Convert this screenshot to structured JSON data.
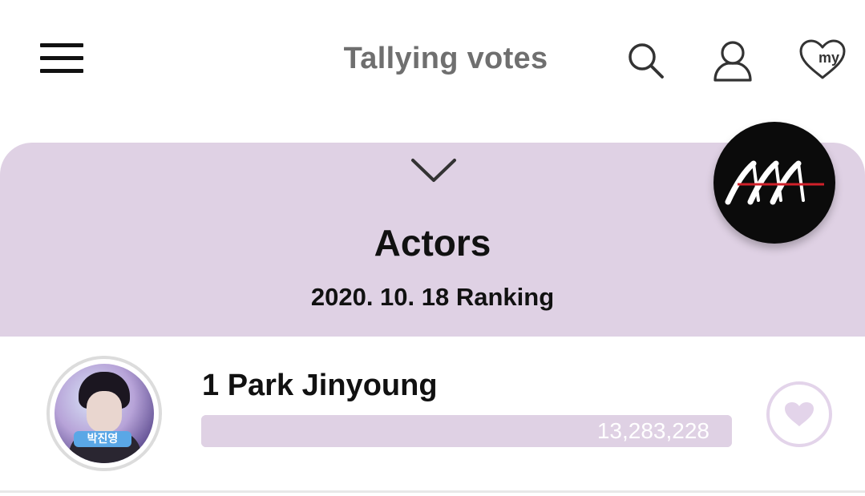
{
  "header": {
    "title": "Tallying votes",
    "my_badge": "my",
    "icons": [
      "menu-icon",
      "search-icon",
      "user-icon",
      "my-heart-icon"
    ]
  },
  "ranking_panel": {
    "category": "Actors",
    "date_label": "2020. 10. 18 Ranking",
    "background_color": "#dfd1e4",
    "collapse_icon": "chevron-down-icon",
    "brand_logo": "brand-logo"
  },
  "rankings": [
    {
      "rank": "1",
      "name": "Park Jinyoung",
      "rank_label": "1  Park Jinyoung",
      "votes": "13,283,228",
      "vote_share": 1.0,
      "avatar_caption": "박진영"
    }
  ],
  "colors": {
    "accent": "#dfd1e4",
    "vote_button_border": "#e3d4ea",
    "title_gray": "#6f6f6f"
  }
}
